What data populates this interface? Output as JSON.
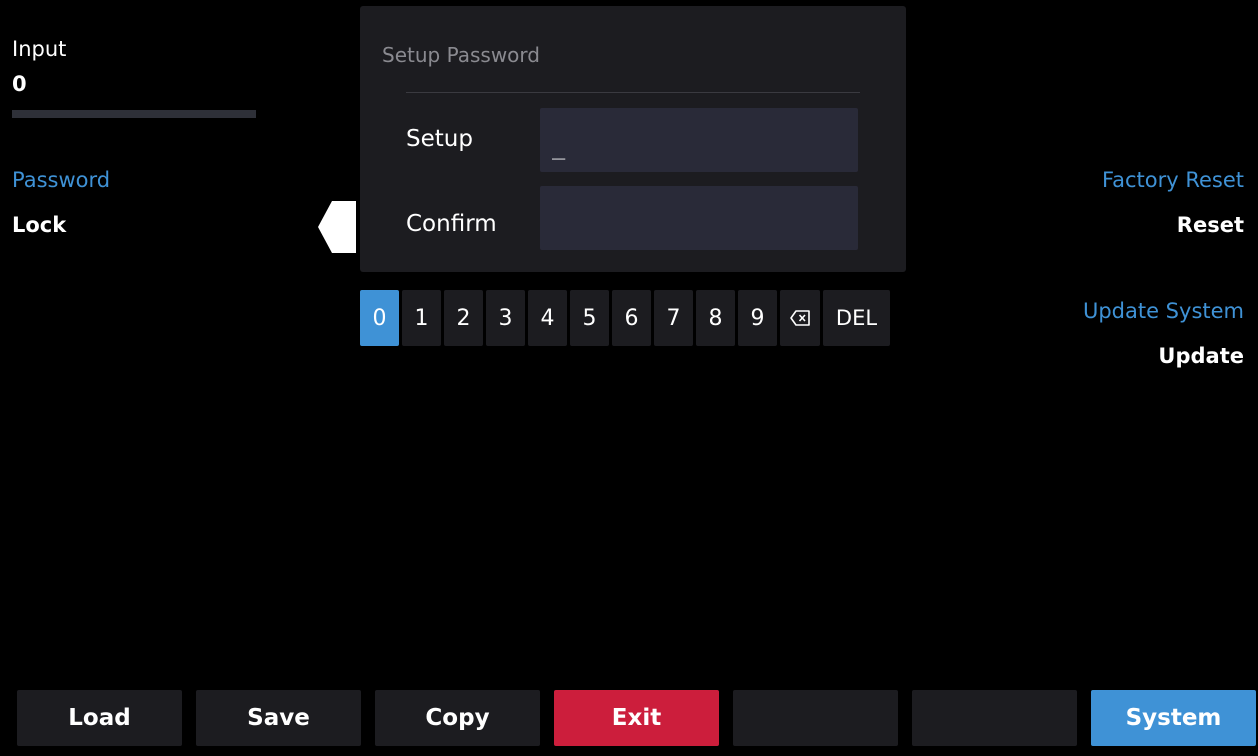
{
  "left": {
    "input_label": "Input",
    "input_value": "0",
    "password_label": "Password",
    "password_value": "Lock"
  },
  "dialog": {
    "title": "Setup Password",
    "setup_label": "Setup",
    "setup_value": "_",
    "confirm_label": "Confirm",
    "confirm_value": ""
  },
  "keypad": {
    "keys": [
      "0",
      "1",
      "2",
      "3",
      "4",
      "5",
      "6",
      "7",
      "8",
      "9"
    ],
    "active_key": "0",
    "backspace_icon": "backspace-icon",
    "del_label": "DEL"
  },
  "right": {
    "factory_reset_label": "Factory Reset",
    "factory_reset_value": "Reset",
    "update_system_label": "Update System",
    "update_system_value": "Update"
  },
  "bottom": {
    "load": "Load",
    "save": "Save",
    "copy": "Copy",
    "exit": "Exit",
    "blank1": "",
    "blank2": "",
    "system": "System"
  },
  "colors": {
    "accent_blue": "#3f92d6",
    "exit_red": "#cc1e3c",
    "panel_bg": "#1c1c20",
    "input_bg": "#292a38",
    "background": "#000000"
  }
}
